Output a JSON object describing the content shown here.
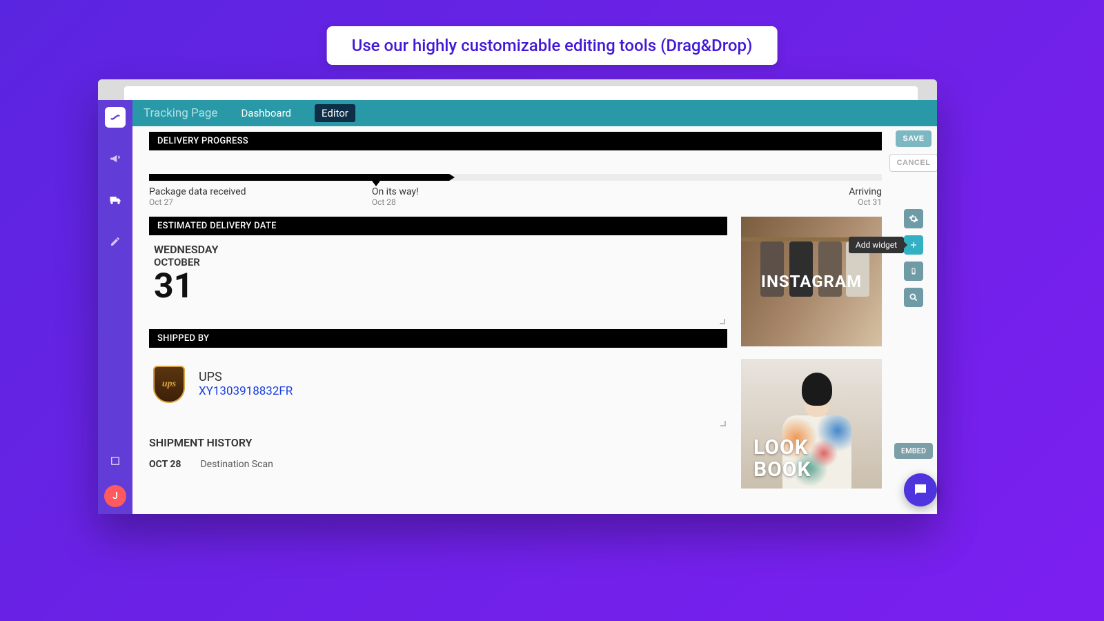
{
  "banner": "Use our highly customizable editing tools (Drag&Drop)",
  "header": {
    "title": "Tracking Page",
    "tabs": [
      "Dashboard",
      "Editor"
    ],
    "active_tab": "Editor"
  },
  "sidebar": {
    "avatar_initial": "J"
  },
  "tools": {
    "save": "SAVE",
    "cancel": "CANCEL",
    "add_widget_tooltip": "Add widget",
    "embed": "EMBED"
  },
  "widgets": {
    "delivery_progress": {
      "title": "DELIVERY PROGRESS",
      "steps": {
        "received": {
          "label": "Package data received",
          "date": "Oct 27"
        },
        "transit": {
          "label": "On its way!",
          "date": "Oct 28"
        },
        "arriving": {
          "label": "Arriving",
          "date": "Oct 31"
        }
      }
    },
    "edd": {
      "title": "ESTIMATED DELIVERY DATE",
      "dow": "WEDNESDAY",
      "month": "OCTOBER",
      "day": "31"
    },
    "shipped_by": {
      "title": "SHIPPED BY",
      "carrier": "UPS",
      "tracking_number": "XY1303918832FR",
      "logo_text": "ups"
    },
    "history": {
      "title": "SHIPMENT HISTORY",
      "rows": [
        {
          "date": "OCT 28",
          "event": "Destination Scan"
        }
      ]
    },
    "promos": {
      "instagram": "INSTAGRAM",
      "lookbook_line1": "LOOK",
      "lookbook_line2": "BOOK"
    }
  }
}
